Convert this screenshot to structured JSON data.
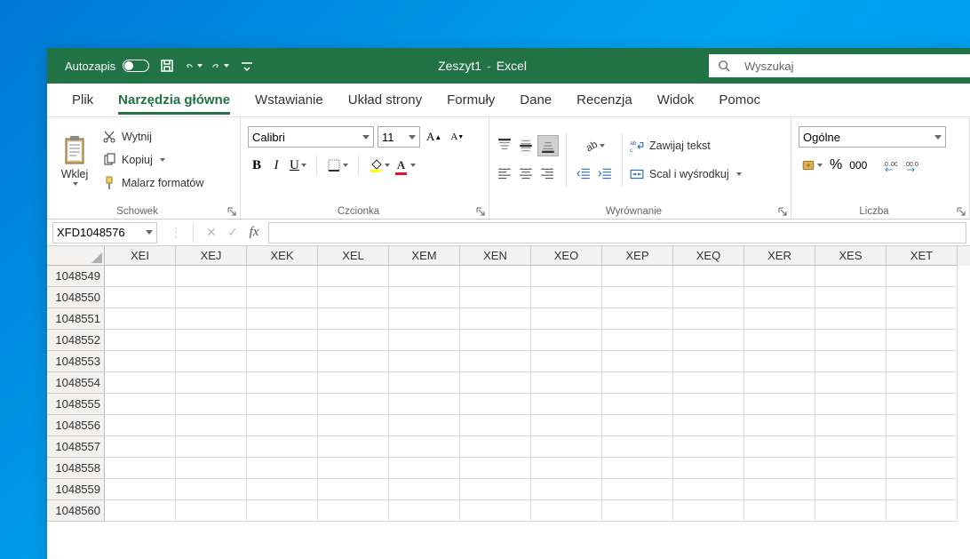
{
  "title": {
    "doc": "Zeszyt1",
    "app": "Excel"
  },
  "autosave_label": "Autozapis",
  "search_placeholder": "Wyszukaj",
  "tabs": {
    "file": "Plik",
    "home": "Narzędzia główne",
    "insert": "Wstawianie",
    "layout": "Układ strony",
    "formulas": "Formuły",
    "data": "Dane",
    "review": "Recenzja",
    "view": "Widok",
    "help": "Pomoc"
  },
  "clipboard": {
    "paste": "Wklej",
    "cut": "Wytnij",
    "copy": "Kopiuj",
    "format_painter": "Malarz formatów",
    "group_label": "Schowek"
  },
  "font": {
    "name": "Calibri",
    "size": "11",
    "group_label": "Czcionka"
  },
  "alignment": {
    "wrap": "Zawijaj tekst",
    "merge": "Scal i wyśrodkuj",
    "group_label": "Wyrównanie"
  },
  "number": {
    "format": "Ogólne",
    "separator": "000",
    "group_label": "Liczba"
  },
  "name_box": "XFD1048576",
  "columns": [
    "XEI",
    "XEJ",
    "XEK",
    "XEL",
    "XEM",
    "XEN",
    "XEO",
    "XEP",
    "XEQ",
    "XER",
    "XES",
    "XET"
  ],
  "rows": [
    "1048549",
    "1048550",
    "1048551",
    "1048552",
    "1048553",
    "1048554",
    "1048555",
    "1048556",
    "1048557",
    "1048558",
    "1048559",
    "1048560"
  ]
}
